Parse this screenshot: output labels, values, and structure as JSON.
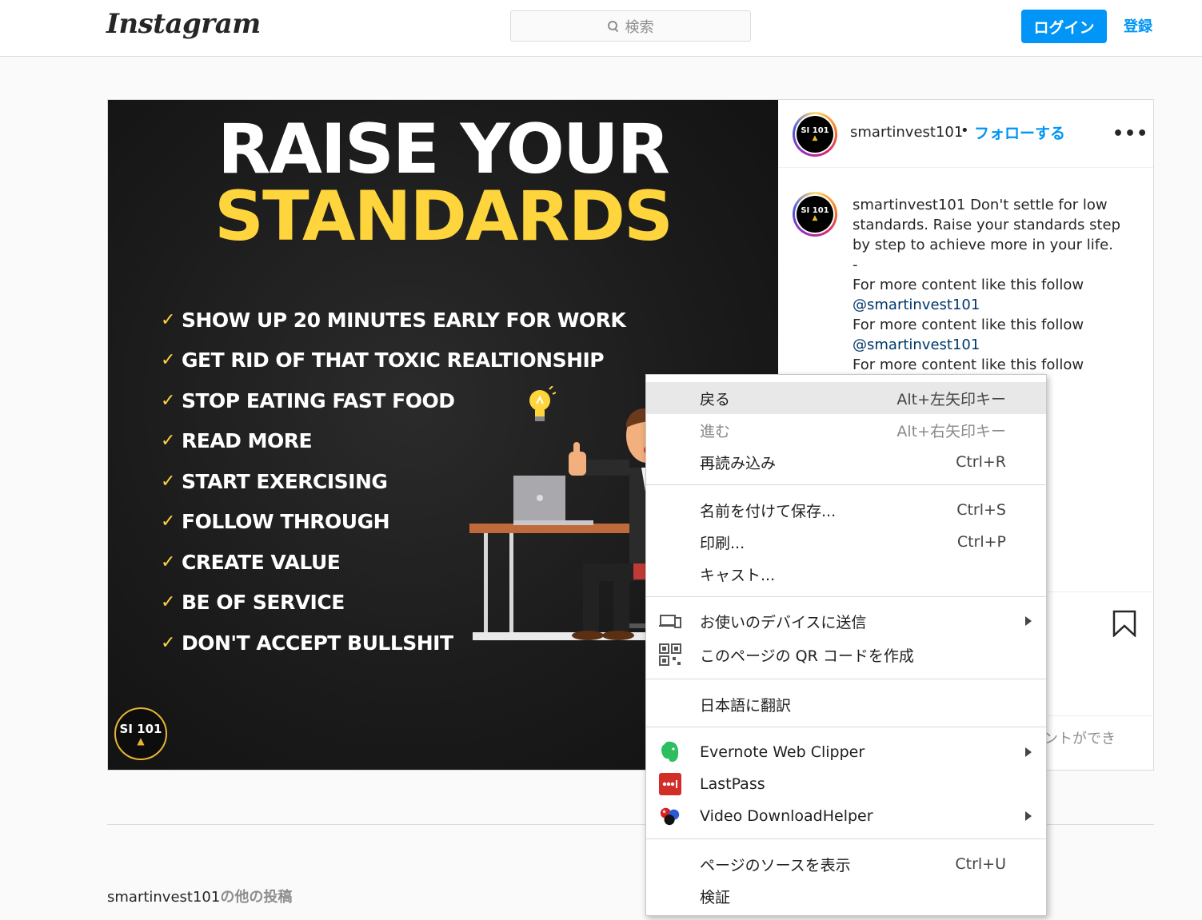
{
  "header": {
    "logo": "Instagram",
    "search_placeholder": "検索",
    "login_label": "ログイン",
    "signup_label": "登録"
  },
  "post": {
    "image": {
      "title_line1": "RAISE YOUR",
      "title_line2": "STANDARDS",
      "items": [
        "SHOW UP 20 MINUTES EARLY FOR WORK",
        "GET RID OF THAT TOXIC REALTIONSHIP",
        "STOP EATING FAST FOOD",
        "READ MORE",
        "START EXERCISING",
        "FOLLOW THROUGH",
        "CREATE VALUE",
        "BE OF SERVICE",
        "DON'T ACCEPT BULLSHIT"
      ],
      "check_mark": "✓",
      "badge_text": "SI 101"
    },
    "username": "smartinvest101",
    "separator": "•",
    "follow_label": "フォローする",
    "more_label": "•••",
    "avatar_text": "SI 101",
    "caption": {
      "username": "smartinvest101",
      "text": "Don't settle for low standards. Raise your standards step by step to achieve more in your life.",
      "dash": "-",
      "line_follow_1": "For more content like this follow",
      "mention_1": "@smartinvest101",
      "line_follow_2": "For more content like this follow",
      "mention_2": "@smartinvest101",
      "line_follow_3": "For more content like this follow"
    },
    "comment_note": "ントができ"
  },
  "more_posts": {
    "username": "smartinvest101",
    "suffix": "の他の投稿"
  },
  "context_menu": {
    "items": [
      {
        "label": "戻る",
        "shortcut": "Alt+左矢印キー"
      },
      {
        "label": "進む",
        "shortcut": "Alt+右矢印キー"
      },
      {
        "label": "再読み込み",
        "shortcut": "Ctrl+R"
      },
      {
        "label": "名前を付けて保存...",
        "shortcut": "Ctrl+S"
      },
      {
        "label": "印刷...",
        "shortcut": "Ctrl+P"
      },
      {
        "label": "キャスト...",
        "shortcut": ""
      },
      {
        "label": "お使いのデバイスに送信",
        "shortcut": ""
      },
      {
        "label": "このページの QR コードを作成",
        "shortcut": ""
      },
      {
        "label": "日本語に翻訳",
        "shortcut": ""
      },
      {
        "label": "Evernote Web Clipper",
        "shortcut": ""
      },
      {
        "label": "LastPass",
        "shortcut": ""
      },
      {
        "label": "Video DownloadHelper",
        "shortcut": ""
      },
      {
        "label": "ページのソースを表示",
        "shortcut": "Ctrl+U"
      },
      {
        "label": "検証",
        "shortcut": ""
      }
    ],
    "icons": {
      "send_to_devices": "devices-icon",
      "qr_code": "qr-code-icon",
      "evernote": "evernote-icon",
      "lastpass": "lastpass-icon",
      "video_downloadhelper": "video-downloadhelper-icon"
    }
  },
  "colors": {
    "accent": "#0095f6",
    "image_yellow": "#ffd53d",
    "menu_highlight": "#e8e8e8"
  }
}
